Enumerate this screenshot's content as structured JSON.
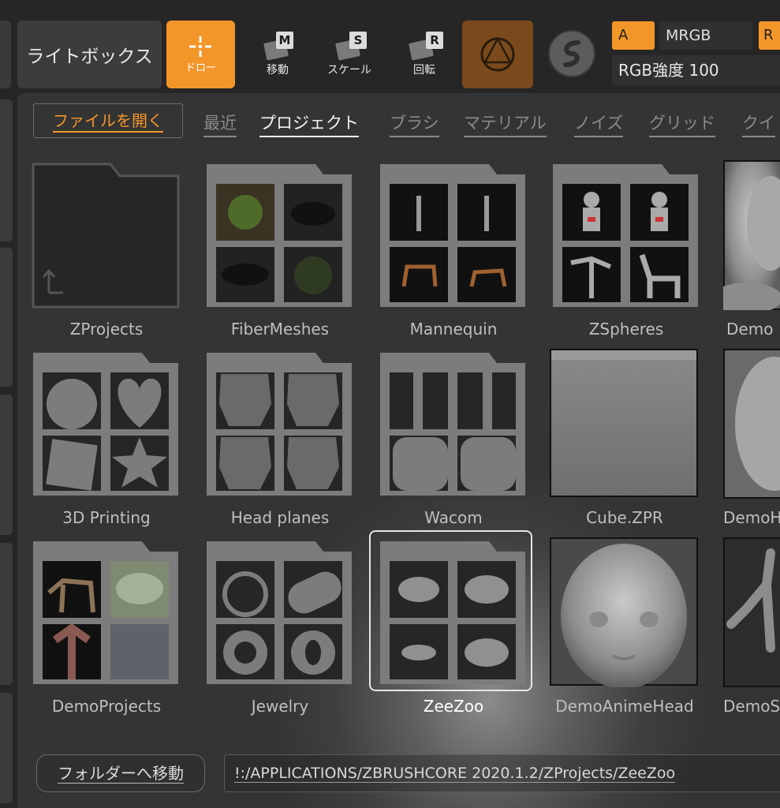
{
  "toolbar": {
    "lightbox_label": "ライトボックス",
    "draw_label": "ドロー",
    "move_label": "移動",
    "move_key": "M",
    "scale_label": "スケール",
    "scale_key": "S",
    "rotate_label": "回転",
    "rotate_key": "R",
    "a_label": "A",
    "mrgb_label": "MRGB",
    "r_label": "R",
    "rgb_intensity_label": "RGB強度 100"
  },
  "panel": {
    "open_file_label": "ファイルを開く",
    "tabs": [
      {
        "label": "最近",
        "active": false
      },
      {
        "label": "プロジェクト",
        "active": true
      },
      {
        "label": "ブラシ",
        "active": false
      },
      {
        "label": "マテリアル",
        "active": false
      },
      {
        "label": "ノイズ",
        "active": false
      },
      {
        "label": "グリッド",
        "active": false
      },
      {
        "label": "クイ",
        "active": false
      }
    ],
    "items": [
      {
        "name": "ZProjects",
        "kind": "folder-empty",
        "icon": "folder-icon"
      },
      {
        "name": "FiberMeshes",
        "kind": "folder",
        "icon": "folder-icon"
      },
      {
        "name": "Mannequin",
        "kind": "folder",
        "icon": "folder-icon"
      },
      {
        "name": "ZSpheres",
        "kind": "folder",
        "icon": "folder-icon"
      },
      {
        "name": "Demo",
        "kind": "project",
        "icon": "head-thumbnail"
      },
      {
        "name": "3D Printing",
        "kind": "folder",
        "icon": "folder-icon"
      },
      {
        "name": "Head planes",
        "kind": "folder",
        "icon": "folder-icon"
      },
      {
        "name": "Wacom",
        "kind": "folder",
        "icon": "folder-icon"
      },
      {
        "name": "Cube.ZPR",
        "kind": "project",
        "icon": "cube-thumbnail"
      },
      {
        "name": "DemoH",
        "kind": "project",
        "icon": "head-thumbnail"
      },
      {
        "name": "DemoProjects",
        "kind": "folder",
        "icon": "folder-icon"
      },
      {
        "name": "Jewelry",
        "kind": "folder",
        "icon": "folder-icon"
      },
      {
        "name": "ZeeZoo",
        "kind": "folder",
        "icon": "folder-icon",
        "selected": true
      },
      {
        "name": "DemoAnimeHead",
        "kind": "project",
        "icon": "head-thumbnail"
      },
      {
        "name": "DemoS",
        "kind": "project",
        "icon": "body-thumbnail"
      }
    ],
    "goto_folder_label": "フォルダーへ移動",
    "path": "!:/APPLICATIONS/ZBRUSHCORE 2020.1.2/ZProjects/ZeeZoo"
  },
  "colors": {
    "accent": "#f39629",
    "material_button": "#7a4a1c",
    "toolbar_bg": "#262626",
    "panel_bg": "#343434"
  }
}
